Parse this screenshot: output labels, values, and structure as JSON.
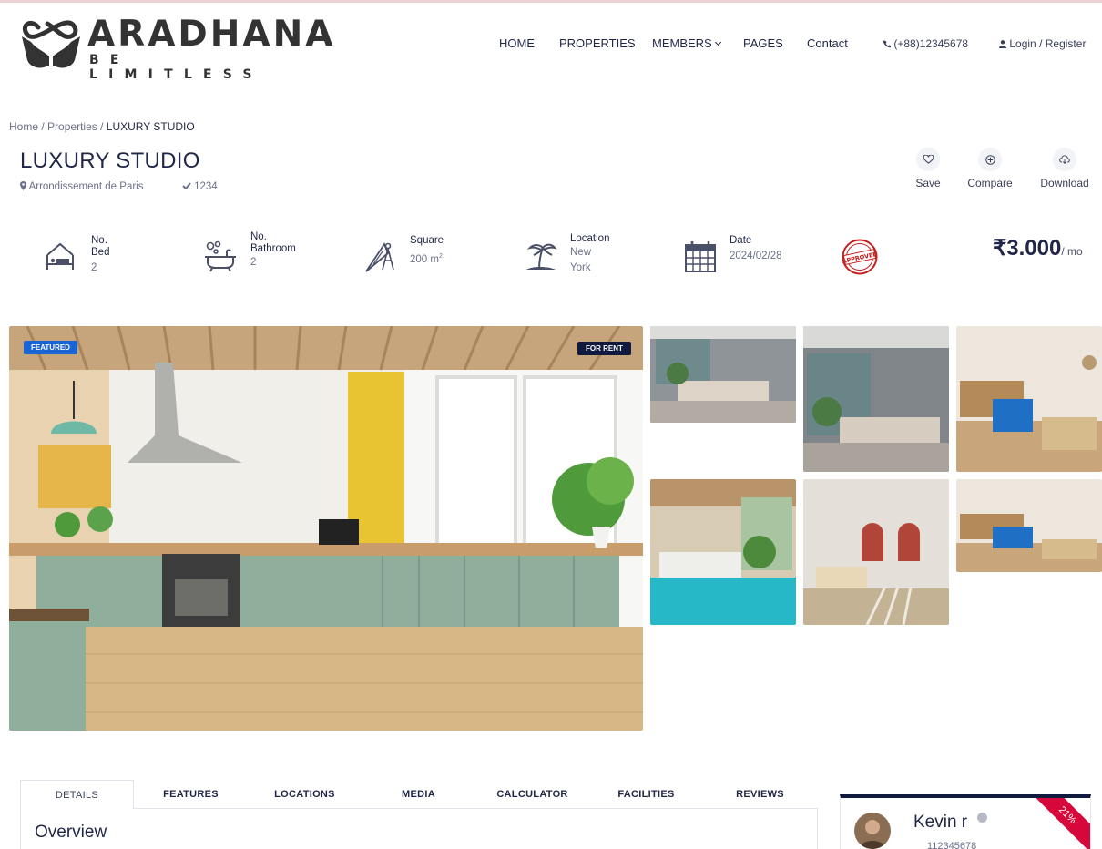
{
  "brand": {
    "name": "ARADHANA",
    "tagline": "BE LIMITLESS"
  },
  "nav": {
    "items": [
      "HOME",
      "PROPERTIES",
      "MEMBERS",
      "PAGES",
      "Contact"
    ],
    "phone": "(+88)12345678",
    "login": "Login",
    "sep": "/",
    "register": "Register"
  },
  "breadcrumb": {
    "home": "Home",
    "sep": "/",
    "properties": "Properties",
    "current": "LUXURY STUDIO"
  },
  "property": {
    "title": "LUXURY STUDIO",
    "address": "Arrondissement de Paris",
    "id": "1234",
    "price": "₹3.000",
    "period": "/ mo",
    "badge_featured": "FEATURED",
    "badge_status": "FOR RENT"
  },
  "actions": [
    "Save",
    "Compare",
    "Download"
  ],
  "specs": {
    "bed": {
      "label": "No. Bed",
      "value": "2"
    },
    "bath": {
      "label": "No. Bathroom",
      "value": "2"
    },
    "square": {
      "label": "Square",
      "value": "200 m",
      "unit_sup": "2"
    },
    "location": {
      "label": "Location",
      "value": "New York"
    },
    "date": {
      "label": "Date",
      "value": "2024/02/28"
    }
  },
  "stamp_text": "APPROVED",
  "tabs": [
    "DETAILS",
    "FEATURES",
    "LOCATIONS",
    "MEDIA",
    "CALCULATOR",
    "FACILITIES",
    "REVIEWS"
  ],
  "overview_title": "Overview",
  "agent": {
    "name": "Kevin r",
    "phone": "112345678",
    "ribbon": "21%"
  },
  "colors": {
    "navy": "#1f2647",
    "featured": "#1863d6",
    "rent": "#101a3f",
    "ribbon": "#d6083b"
  }
}
